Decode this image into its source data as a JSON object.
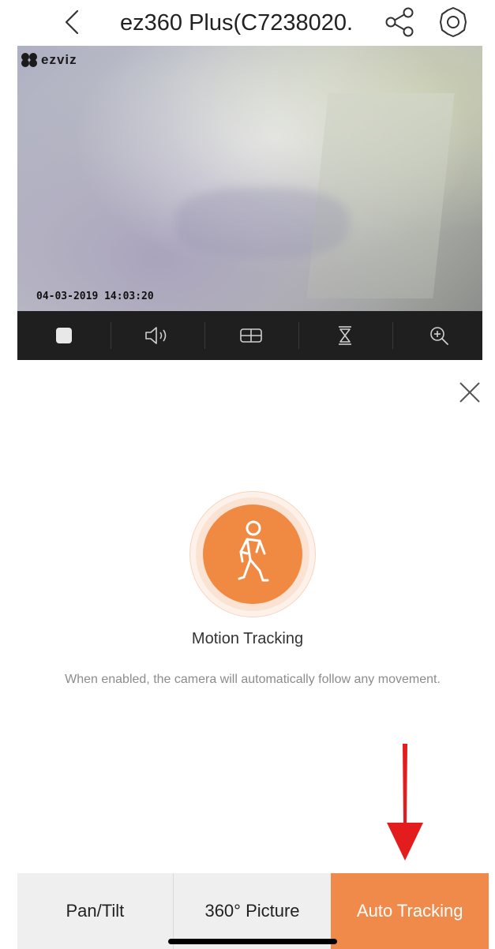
{
  "header": {
    "title": "ez360 Plus(C7238020."
  },
  "video": {
    "logo_text": "ezviz",
    "timestamp": "04-03-2019 14:03:20"
  },
  "toolbar": {
    "items": [
      "stop-icon",
      "volume-icon",
      "grid-icon",
      "hourglass-icon",
      "zoom-in-icon"
    ]
  },
  "panel": {
    "title": "Motion Tracking",
    "description": "When enabled, the camera will automatically follow any movement."
  },
  "tabs": [
    {
      "label": "Pan/Tilt",
      "active": false
    },
    {
      "label": "360° Picture",
      "active": false
    },
    {
      "label": "Auto Tracking",
      "active": true
    }
  ],
  "colors": {
    "accent": "#f08a43",
    "arrow": "#e31d1d",
    "toolbar": "#1f1f1f"
  }
}
